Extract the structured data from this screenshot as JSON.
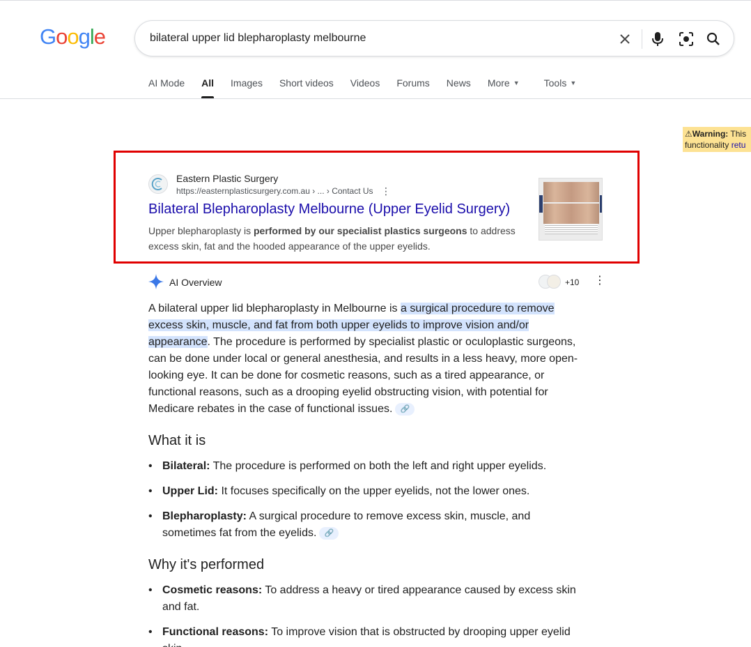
{
  "search": {
    "query": "bilateral upper lid blepharoplasty melbourne"
  },
  "logo": {
    "letters": [
      "G",
      "o",
      "o",
      "g",
      "l",
      "e"
    ],
    "colors": [
      "#4285F4",
      "#EA4335",
      "#FBBC05",
      "#4285F4",
      "#34A853",
      "#EA4335"
    ]
  },
  "tabs": [
    {
      "label": "AI Mode"
    },
    {
      "label": "All"
    },
    {
      "label": "Images"
    },
    {
      "label": "Short videos"
    },
    {
      "label": "Videos"
    },
    {
      "label": "Forums"
    },
    {
      "label": "News"
    },
    {
      "label": "More"
    },
    {
      "label": "Tools"
    }
  ],
  "warning": {
    "label": "⚠Warning:",
    "text": " This",
    "line2": "functionality ",
    "link": "retu"
  },
  "result": {
    "site_name": "Eastern Plastic Surgery",
    "url": "https://easternplasticsurgery.com.au › ... › Contact Us",
    "title": "Bilateral Blepharoplasty Melbourne (Upper Eyelid Surgery)",
    "snippet_pre": "Upper blepharoplasty is ",
    "snippet_bold": "performed by our specialist plastics surgeons",
    "snippet_post": " to address excess skin, fat and the hooded appearance of the upper eyelids."
  },
  "ai_overview": {
    "label": "AI Overview",
    "source_count": "+10",
    "intro_pre": "A bilateral upper lid blepharoplasty in Melbourne is ",
    "intro_highlight": "a surgical procedure to remove excess skin, muscle, and fat from both upper eyelids to improve vision and/or appearance",
    "intro_post": ". The procedure is performed by specialist plastic or oculoplastic surgeons, can be done under local or general anesthesia, and results in a less heavy, more open-looking eye. It can be done for cosmetic reasons, such as a tired appearance, or functional reasons, such as a drooping eyelid obstructing vision, with potential for Medicare rebates in the case of functional issues.",
    "section1": {
      "heading": "What it is",
      "items": [
        {
          "term": "Bilateral:",
          "text": " The procedure is performed on both the left and right upper eyelids."
        },
        {
          "term": "Upper Lid:",
          "text": " It focuses specifically on the upper eyelids, not the lower ones."
        },
        {
          "term": "Blepharoplasty:",
          "text": " A surgical procedure to remove excess skin, muscle, and sometimes fat from the eyelids."
        }
      ]
    },
    "section2": {
      "heading": "Why it's performed",
      "items": [
        {
          "term": "Cosmetic reasons:",
          "text": " To address a heavy or tired appearance caused by excess skin and fat."
        },
        {
          "term": "Functional reasons:",
          "text": " To improve vision that is obstructed by drooping upper eyelid skin."
        }
      ]
    }
  },
  "colors": {
    "link": "#1a0dab",
    "highlight": "#d3e3fd",
    "frame": "#e00000",
    "warning_bg": "#fde293"
  }
}
